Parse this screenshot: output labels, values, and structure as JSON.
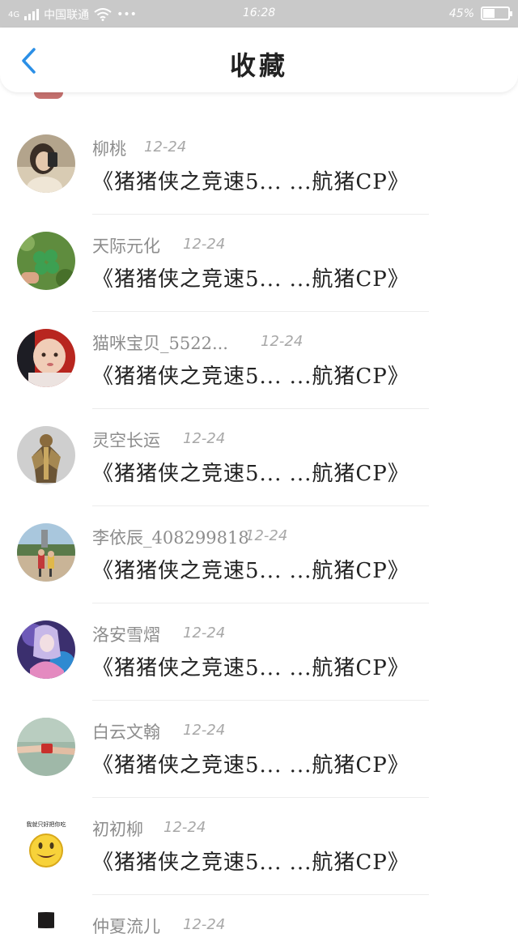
{
  "status_bar": {
    "carrier": "中国联通",
    "signal_label": "4G",
    "dots": "•••",
    "time": "16:28",
    "battery": "45%"
  },
  "header": {
    "title": "收藏",
    "back_icon": "chevron-left-icon"
  },
  "items": [
    {
      "name": "柳桃",
      "date": "12-24",
      "topic": "《猪猪侠之竞速5... ...航猪CP》",
      "avatar": "girl-selfie"
    },
    {
      "name": "天际元化",
      "date": "12-24",
      "topic": "《猪猪侠之竞速5... ...航猪CP》",
      "avatar": "clover"
    },
    {
      "name": "猫咪宝贝_5522...",
      "date": "12-24",
      "topic": "《猪猪侠之竞速5... ...航猪CP》",
      "avatar": "baby"
    },
    {
      "name": "灵空长运",
      "date": "12-24",
      "topic": "《猪猪侠之竞速5... ...航猪CP》",
      "avatar": "armored-warrior"
    },
    {
      "name": "李依辰_408299818",
      "date": "12-24",
      "topic": "《猪猪侠之竞速5... ...航猪CP》",
      "avatar": "kids-outdoor"
    },
    {
      "name": "洛安雪熠",
      "date": "12-24",
      "topic": "《猪猪侠之竞速5... ...航猪CP》",
      "avatar": "anime-girl"
    },
    {
      "name": "白云文翰",
      "date": "12-24",
      "topic": "《猪猪侠之竞速5... ...航猪CP》",
      "avatar": "hands-gift"
    },
    {
      "name": "初初柳",
      "date": "12-24",
      "topic": "《猪猪侠之竞速5... ...航猪CP》",
      "avatar": "smiley-emoji",
      "avatar_text": "我就只好把你吃"
    }
  ],
  "partial_bottom_item": {
    "name": "仲夏流儿",
    "date": "12-24"
  },
  "colors": {
    "status_bar_bg": "#c9c9c9",
    "accent_blue": "#2b8fe6",
    "name_gray": "#8d8d8d",
    "topic_dark": "#222222"
  }
}
